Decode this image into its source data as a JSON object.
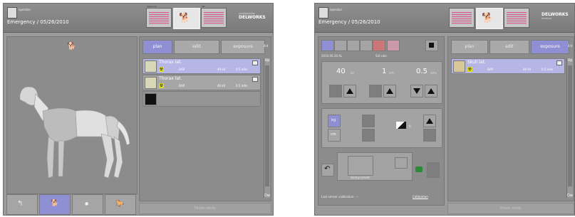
{
  "left": {
    "header": {
      "operator_label": "operator",
      "title": "Emergency / 05/26/2010",
      "thumb1_mini": "exposure",
      "thumb3_mini": "list",
      "thumb4_mini": "configuration",
      "brand": "DELWORKS",
      "brand_sub": "medical"
    },
    "tabs": [
      "plan",
      "edit",
      "exposure"
    ],
    "tab_extra": "4/4",
    "rows": [
      {
        "name": "Thorax lat.",
        "dap": "DAP",
        "kv": "40 kV",
        "mas": "0.5 mAs"
      },
      {
        "name": "Thorax lat.",
        "dap": "DAP",
        "kv": "40 kV",
        "mas": "0.5 mAs"
      },
      {
        "name": "",
        "dap": "",
        "kv": "",
        "mas": ""
      }
    ],
    "scroll_up": "Up",
    "scroll_down": "Dw",
    "finish": "Finish study",
    "icons": [
      "stairs-icon",
      "dog-icon",
      "cat-icon",
      "horse-icon"
    ]
  },
  "right": {
    "header": {
      "operator_label": "operator",
      "title": "Emergency / 05/26/2010",
      "brand": "DELWORKS",
      "brand_sub": "medical"
    },
    "tabs": [
      "plan",
      "edit",
      "exposure"
    ],
    "tab_extra": "4/4",
    "rows": [
      {
        "name": "Skull lat.",
        "dap": "DAP",
        "kv": "40 kV",
        "mas": "0.5 mAs"
      }
    ],
    "date_small": "2010.05.26 AL",
    "ctrl_small": "Sid cabi",
    "kv_value": "40",
    "kv_unit": "kV",
    "ma_value": "1",
    "ma_unit": "mA",
    "mas_value": "0.5",
    "mas_unit": "mAs",
    "kg_label": "kg",
    "cm_label": "cm",
    "density_value": "0",
    "preset_label": "skinny preset",
    "calibration_label": "Last sensor calibration: ---",
    "calibration_button": "Calibration",
    "scroll_up": "Up",
    "scroll_down": "Dw",
    "finish": "Finish study"
  }
}
